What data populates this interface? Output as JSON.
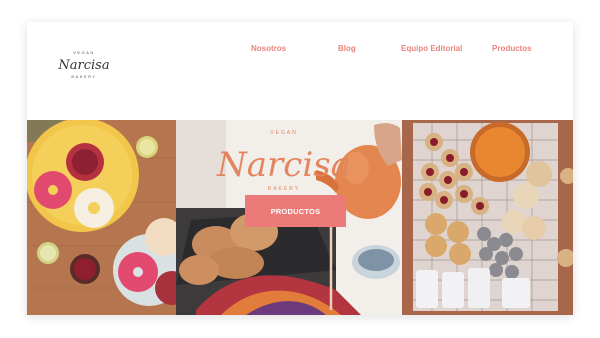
{
  "brand": {
    "name": "Narcisa",
    "tagline_top": "VEGAN",
    "tagline_bottom": "BAKERY"
  },
  "nav": {
    "items": [
      {
        "label": "Nosotros"
      },
      {
        "label": "Blog"
      },
      {
        "label": "Equipo Editorial"
      },
      {
        "label": "Productos"
      }
    ]
  },
  "hero": {
    "cta_label": "PRODUCTOS"
  },
  "colors": {
    "accent": "#ec7a78",
    "nav_text": "#e9857d",
    "logo_ink": "#333333",
    "hero_logo": "#e3865f"
  }
}
